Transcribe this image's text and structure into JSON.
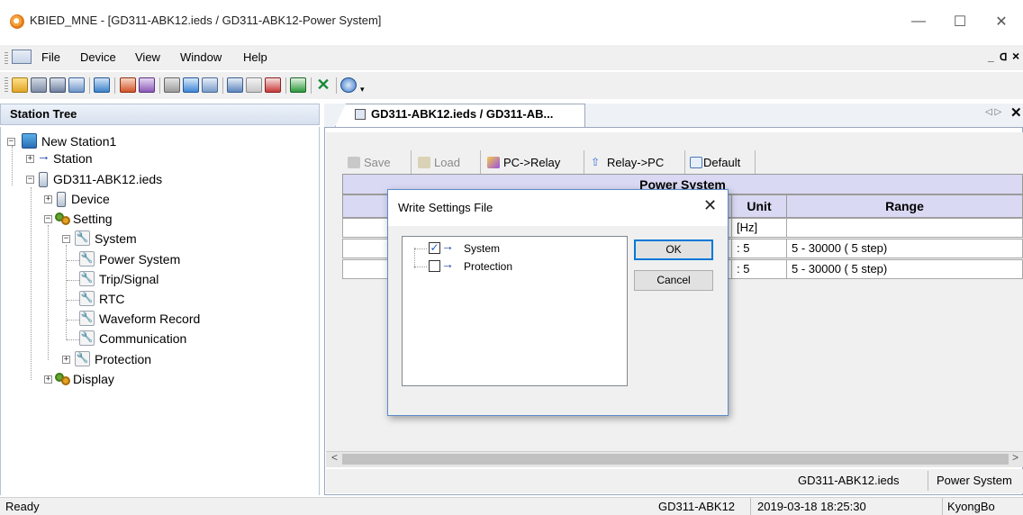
{
  "window": {
    "title": "KBIED_MNE - [GD311-ABK12.ieds / GD311-ABK12-Power System]",
    "minimize_glyph": "—",
    "maximize_glyph": "☐",
    "close_glyph": "✕"
  },
  "menu": {
    "items": [
      "File",
      "Device",
      "View",
      "Window",
      "Help"
    ],
    "mdi_minimize": "_",
    "mdi_restore": "🗗",
    "mdi_close": "×"
  },
  "toolbar": {
    "icons": [
      "open-icon",
      "save-icon",
      "save-all-icon",
      "network-icon",
      "tree-icon",
      "import-icon",
      "export-icon",
      "wizard-icon",
      "monitor-icon",
      "grid-icon",
      "list-icon",
      "connect-icon",
      "disconnect-icon",
      "upload-icon",
      "exit-icon",
      "help-icon",
      "overflow-icon"
    ]
  },
  "station_tree": {
    "header": "Station Tree",
    "nodes": [
      {
        "label": "New Station1",
        "icon": "station-icon"
      },
      {
        "label": "Station",
        "icon": "arrow-icon"
      },
      {
        "label": "GD311-ABK12.ieds",
        "icon": "device-file-icon"
      },
      {
        "label": "Device",
        "icon": "device-file-icon"
      },
      {
        "label": "Setting",
        "icon": "gear-icon"
      },
      {
        "label": "System",
        "icon": "wrench-icon"
      },
      {
        "label": "Power System",
        "icon": "wrench-icon"
      },
      {
        "label": "Trip/Signal",
        "icon": "wrench-icon"
      },
      {
        "label": "RTC",
        "icon": "wrench-icon"
      },
      {
        "label": "Waveform Record",
        "icon": "wrench-icon"
      },
      {
        "label": "Communication",
        "icon": "wrench-icon"
      },
      {
        "label": "Protection",
        "icon": "wrench-icon"
      },
      {
        "label": "Display",
        "icon": "gear-icon"
      }
    ]
  },
  "document": {
    "tab_label": "GD311-ABK12.ieds / GD311-AB...",
    "tab_scroll": "◁ ▷",
    "tab_close": "✕",
    "buttons": {
      "save": "Save",
      "load": "Load",
      "pc_to_relay": "PC->Relay",
      "relay_to_pc": "Relay->PC",
      "default": "Default"
    },
    "grid": {
      "title": "Power System",
      "headers": {
        "unit": "Unit",
        "range": "Range"
      },
      "rows": [
        {
          "unit": "[Hz]",
          "range": ""
        },
        {
          "unit": ": 5",
          "range": "5 - 30000 ( 5 step)"
        },
        {
          "unit": ": 5",
          "range": "5 - 30000 ( 5 step)"
        }
      ]
    },
    "scroll_left": "<",
    "scroll_right": ">",
    "status": {
      "file": "GD311-ABK12.ieds",
      "page": "Power System"
    }
  },
  "dialog": {
    "title": "Write Settings File",
    "close_glyph": "✕",
    "items": [
      {
        "label": "System",
        "checked": true
      },
      {
        "label": "Protection",
        "checked": false
      }
    ],
    "ok_label": "OK",
    "cancel_label": "Cancel"
  },
  "statusbar": {
    "left": "Ready",
    "device": "GD311-ABK12",
    "datetime": "2019-03-18 18:25:30",
    "company": "KyongBo"
  }
}
